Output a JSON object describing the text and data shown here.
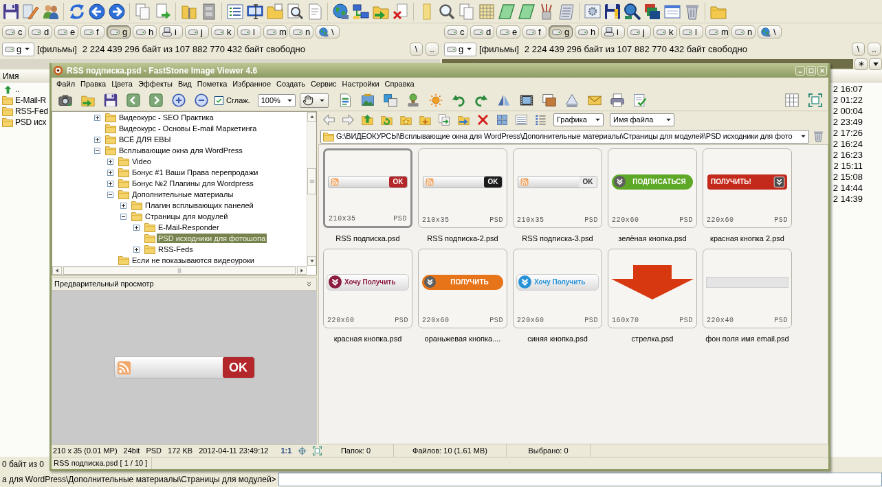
{
  "commander": {
    "drive_bars": [
      {
        "drives": [
          {
            "letter": "c",
            "kind": "disk",
            "selected": false
          },
          {
            "letter": "d",
            "kind": "disk",
            "selected": false
          },
          {
            "letter": "e",
            "kind": "disk",
            "selected": false
          },
          {
            "letter": "f",
            "kind": "disk",
            "selected": false
          },
          {
            "letter": "g",
            "kind": "disk",
            "selected": true
          },
          {
            "letter": "h",
            "kind": "disk",
            "selected": false
          },
          {
            "letter": "i",
            "kind": "network",
            "selected": false
          },
          {
            "letter": "j",
            "kind": "disk",
            "selected": false
          },
          {
            "letter": "k",
            "kind": "disk",
            "selected": false
          },
          {
            "letter": "l",
            "kind": "disk",
            "selected": false
          },
          {
            "letter": "m",
            "kind": "disk",
            "selected": false
          },
          {
            "letter": "n",
            "kind": "disk",
            "selected": false
          },
          {
            "letter": "\\",
            "kind": "root",
            "selected": false
          }
        ]
      },
      {
        "drives": [
          {
            "letter": "c",
            "kind": "disk",
            "selected": false
          },
          {
            "letter": "d",
            "kind": "disk",
            "selected": false
          },
          {
            "letter": "e",
            "kind": "disk",
            "selected": false
          },
          {
            "letter": "f",
            "kind": "disk",
            "selected": false
          },
          {
            "letter": "g",
            "kind": "disk",
            "selected": true
          },
          {
            "letter": "h",
            "kind": "disk",
            "selected": false
          },
          {
            "letter": "i",
            "kind": "network",
            "selected": false
          },
          {
            "letter": "j",
            "kind": "disk",
            "selected": false
          },
          {
            "letter": "k",
            "kind": "disk",
            "selected": false
          },
          {
            "letter": "l",
            "kind": "disk",
            "selected": false
          },
          {
            "letter": "m",
            "kind": "disk",
            "selected": false
          },
          {
            "letter": "n",
            "kind": "disk",
            "selected": false
          },
          {
            "letter": "\\",
            "kind": "root",
            "selected": false
          }
        ]
      }
    ],
    "path_bars": [
      {
        "drive": "g",
        "volume": "[фильмы]",
        "free_space": "2 224 439 296 байт из 107 882 770 432 байт свободно",
        "buttons": [
          "\\",
          ".."
        ]
      },
      {
        "drive": "g",
        "volume": "[фильмы]",
        "free_space": "2 224 439 296 байт из 107 882 770 432 байт свободно",
        "buttons": [
          "\\",
          ".."
        ]
      }
    ],
    "left_panel": {
      "column": "Имя",
      "rows": [
        {
          "kind": "up",
          "name": ".."
        },
        {
          "kind": "folder",
          "name": "E-Mail-R"
        },
        {
          "kind": "folder",
          "name": "RSS-Fed"
        },
        {
          "kind": "folder",
          "name": "PSD исх"
        }
      ]
    },
    "right_panel": {
      "rows": [
        "2 16:07",
        "2 01:22",
        "2 00:04",
        "2 23:49",
        "2 17:26",
        "2 16:24",
        "2 16:23",
        "2 15:11",
        "2 15:08",
        "2 14:44",
        "2 14:39"
      ]
    },
    "status": "0 байт из 0",
    "command_line": {
      "prompt": "а для WordPress\\Дополнительные материалы\\Страницы для модулей>"
    }
  },
  "viewer": {
    "title": "RSS подписка.psd - FastStone Image Viewer 4.6",
    "menu": [
      "Файл",
      "Правка",
      "Цвета",
      "Эффекты",
      "Вид",
      "Пометка",
      "Избранное",
      "Создать",
      "Сервис",
      "Настройки",
      "Справка"
    ],
    "smoothing": {
      "label": "Сглаж.",
      "checked": true
    },
    "zoom": "100%",
    "tree": [
      {
        "name": "Видеокурс - SEO Практика",
        "expandable": true,
        "expanded": false,
        "selected": false
      },
      {
        "name": "Видеокурс - Основы E-mail Маркетинга",
        "expandable": false,
        "expanded": false,
        "selected": false
      },
      {
        "name": "ВСЁ ДЛЯ ЕВЫ",
        "expandable": true,
        "expanded": false,
        "selected": false
      },
      {
        "name": "Всплывающие окна для WordPress",
        "expandable": true,
        "expanded": true,
        "selected": false,
        "children": [
          {
            "name": "Video",
            "expandable": true,
            "expanded": false,
            "selected": false
          },
          {
            "name": "Бонус #1 Ваши Права перепродажи",
            "expandable": true,
            "expanded": false,
            "selected": false
          },
          {
            "name": "Бонус №2 Плагины для Wordpress",
            "expandable": true,
            "expanded": false,
            "selected": false
          },
          {
            "name": "Дополнительные материалы",
            "expandable": true,
            "expanded": true,
            "selected": false,
            "children": [
              {
                "name": "Плагин всплывающих панелей",
                "expandable": true,
                "expanded": false,
                "selected": false
              },
              {
                "name": "Страницы для модулей",
                "expandable": true,
                "expanded": true,
                "selected": false,
                "children": [
                  {
                    "name": "E-Mail-Responder",
                    "expandable": true,
                    "expanded": false,
                    "selected": false
                  },
                  {
                    "name": "PSD исходники для фотошопа",
                    "expandable": false,
                    "expanded": false,
                    "selected": true
                  },
                  {
                    "name": "RSS-Feds",
                    "expandable": true,
                    "expanded": false,
                    "selected": false
                  }
                ]
              }
            ]
          },
          {
            "name": "Если не показываются видеоуроки",
            "expandable": false,
            "expanded": false,
            "selected": false
          }
        ]
      }
    ],
    "preview": {
      "title": "Предварительный просмотр",
      "graphic": {
        "kind": "rss_field",
        "text": "OK",
        "color": "#b3262a"
      }
    },
    "image_info": [
      "210 x 35 (0.01 MP)",
      "24bit",
      "PSD",
      "172 KB",
      "2012-04-11 23:49:12"
    ],
    "actual_size": "1:1",
    "filter": "Графика",
    "sort": "Имя файла",
    "path": "G:\\ВИДЕОКУРСЫ\\Всплывающие окна для WordPress\\Дополнительные материалы\\Страницы для модулей\\PSD исходники для фото",
    "thumbnails": [
      {
        "name": "RSS подписка.psd",
        "size": "210x35",
        "format": "PSD",
        "selected": true,
        "graphic": {
          "kind": "rss_field",
          "text": "OK",
          "color": "#b3262a"
        }
      },
      {
        "name": "RSS подписка-2.psd",
        "size": "210x35",
        "format": "PSD",
        "selected": false,
        "graphic": {
          "kind": "rss_field",
          "text": "OK",
          "color": "#1c1c1c"
        }
      },
      {
        "name": "RSS подписка-3.psd",
        "size": "210x35",
        "format": "PSD",
        "selected": false,
        "graphic": {
          "kind": "rss_field",
          "text": "OK",
          "color": "#eeeeee"
        }
      },
      {
        "name": "зелёная кнопка.psd",
        "size": "220x60",
        "format": "PSD",
        "selected": false,
        "graphic": {
          "kind": "pill",
          "text": "ПОДПИСАТЬСЯ",
          "color": "#5da826"
        }
      },
      {
        "name": "красная кнопка 2.psd",
        "size": "220x60",
        "format": "PSD",
        "selected": false,
        "graphic": {
          "kind": "bar",
          "text": "ПОЛУЧИТЬ!",
          "color": "#c42a1c"
        }
      },
      {
        "name": "красная кнопка.psd",
        "size": "220x60",
        "format": "PSD",
        "selected": false,
        "graphic": {
          "kind": "badge",
          "text": "Хочу Получить",
          "color": "#8c1c40"
        }
      },
      {
        "name": "ораньжевая кнопка....",
        "size": "220x60",
        "format": "PSD",
        "selected": false,
        "graphic": {
          "kind": "pill",
          "text": "ПОЛУЧИТЬ",
          "color": "#e8741a"
        }
      },
      {
        "name": "синяя кнопка.psd",
        "size": "220x60",
        "format": "PSD",
        "selected": false,
        "graphic": {
          "kind": "badge",
          "text": "Хочу Получить",
          "color": "#2a93d8"
        }
      },
      {
        "name": "стрелка.psd",
        "size": "160x70",
        "format": "PSD",
        "selected": false,
        "graphic": {
          "kind": "arrow",
          "color": "#d8380f"
        }
      },
      {
        "name": "фон поля имя email.psd",
        "size": "220x40",
        "format": "PSD",
        "selected": false,
        "graphic": {
          "kind": "field",
          "color": "#e4e4e4"
        }
      }
    ],
    "browser_status": [
      "Папок: 0",
      "Файлов: 10 (1.61 MB)",
      "Выбрано: 0"
    ],
    "status": "RSS подписка.psd [ 1 / 10 ]"
  }
}
